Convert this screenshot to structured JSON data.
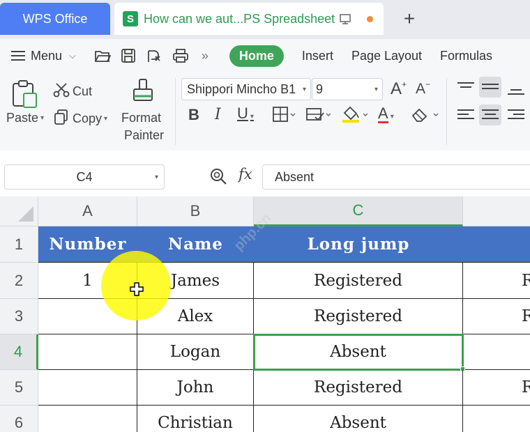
{
  "titlebar": {
    "app_tab": "WPS Office",
    "doc_tab": "How can we aut...PS Spreadsheet",
    "doc_icon_letter": "S",
    "new_tab_symbol": "+"
  },
  "menu": {
    "menu_label": "Menu",
    "more_symbol": "»",
    "tabs": [
      {
        "label": "Home",
        "active": true
      },
      {
        "label": "Insert"
      },
      {
        "label": "Page Layout"
      },
      {
        "label": "Formulas"
      }
    ]
  },
  "ribbon": {
    "paste": "Paste",
    "cut": "Cut",
    "copy": "Copy",
    "format_painter_1": "Format",
    "format_painter_2": "Painter",
    "font_name": "Shippori Mincho B1",
    "font_size": "9",
    "bold": "B",
    "italic": "I",
    "underline": "U",
    "increase_font": "A",
    "decrease_font": "A",
    "font_color_letter": "A",
    "colors": {
      "accent": "#3fa55a",
      "font_color_bar": "#e03434",
      "fill_color_bar": "#f3e000"
    }
  },
  "formula_bar": {
    "name_box": "C4",
    "fx_label": "fx",
    "content": "Absent"
  },
  "sheet": {
    "columns": [
      "A",
      "B",
      "C"
    ],
    "selected_column": "C",
    "rows": [
      "1",
      "2",
      "3",
      "4",
      "5",
      "6"
    ],
    "selected_row": "4",
    "header_row": [
      "Number",
      "Name",
      "Long jump"
    ],
    "data": [
      [
        "1",
        "James",
        "Registered",
        "R"
      ],
      [
        "",
        "Alex",
        "Registered",
        "R"
      ],
      [
        "",
        "Logan",
        "Absent",
        ""
      ],
      [
        "",
        "John",
        "Registered",
        "R"
      ],
      [
        "",
        "Christian",
        "Absent",
        ""
      ]
    ],
    "selected_cell": "C4",
    "header_fill": "#4472c4",
    "selection_color": "#3c9f4c"
  },
  "watermark": "php.cn"
}
